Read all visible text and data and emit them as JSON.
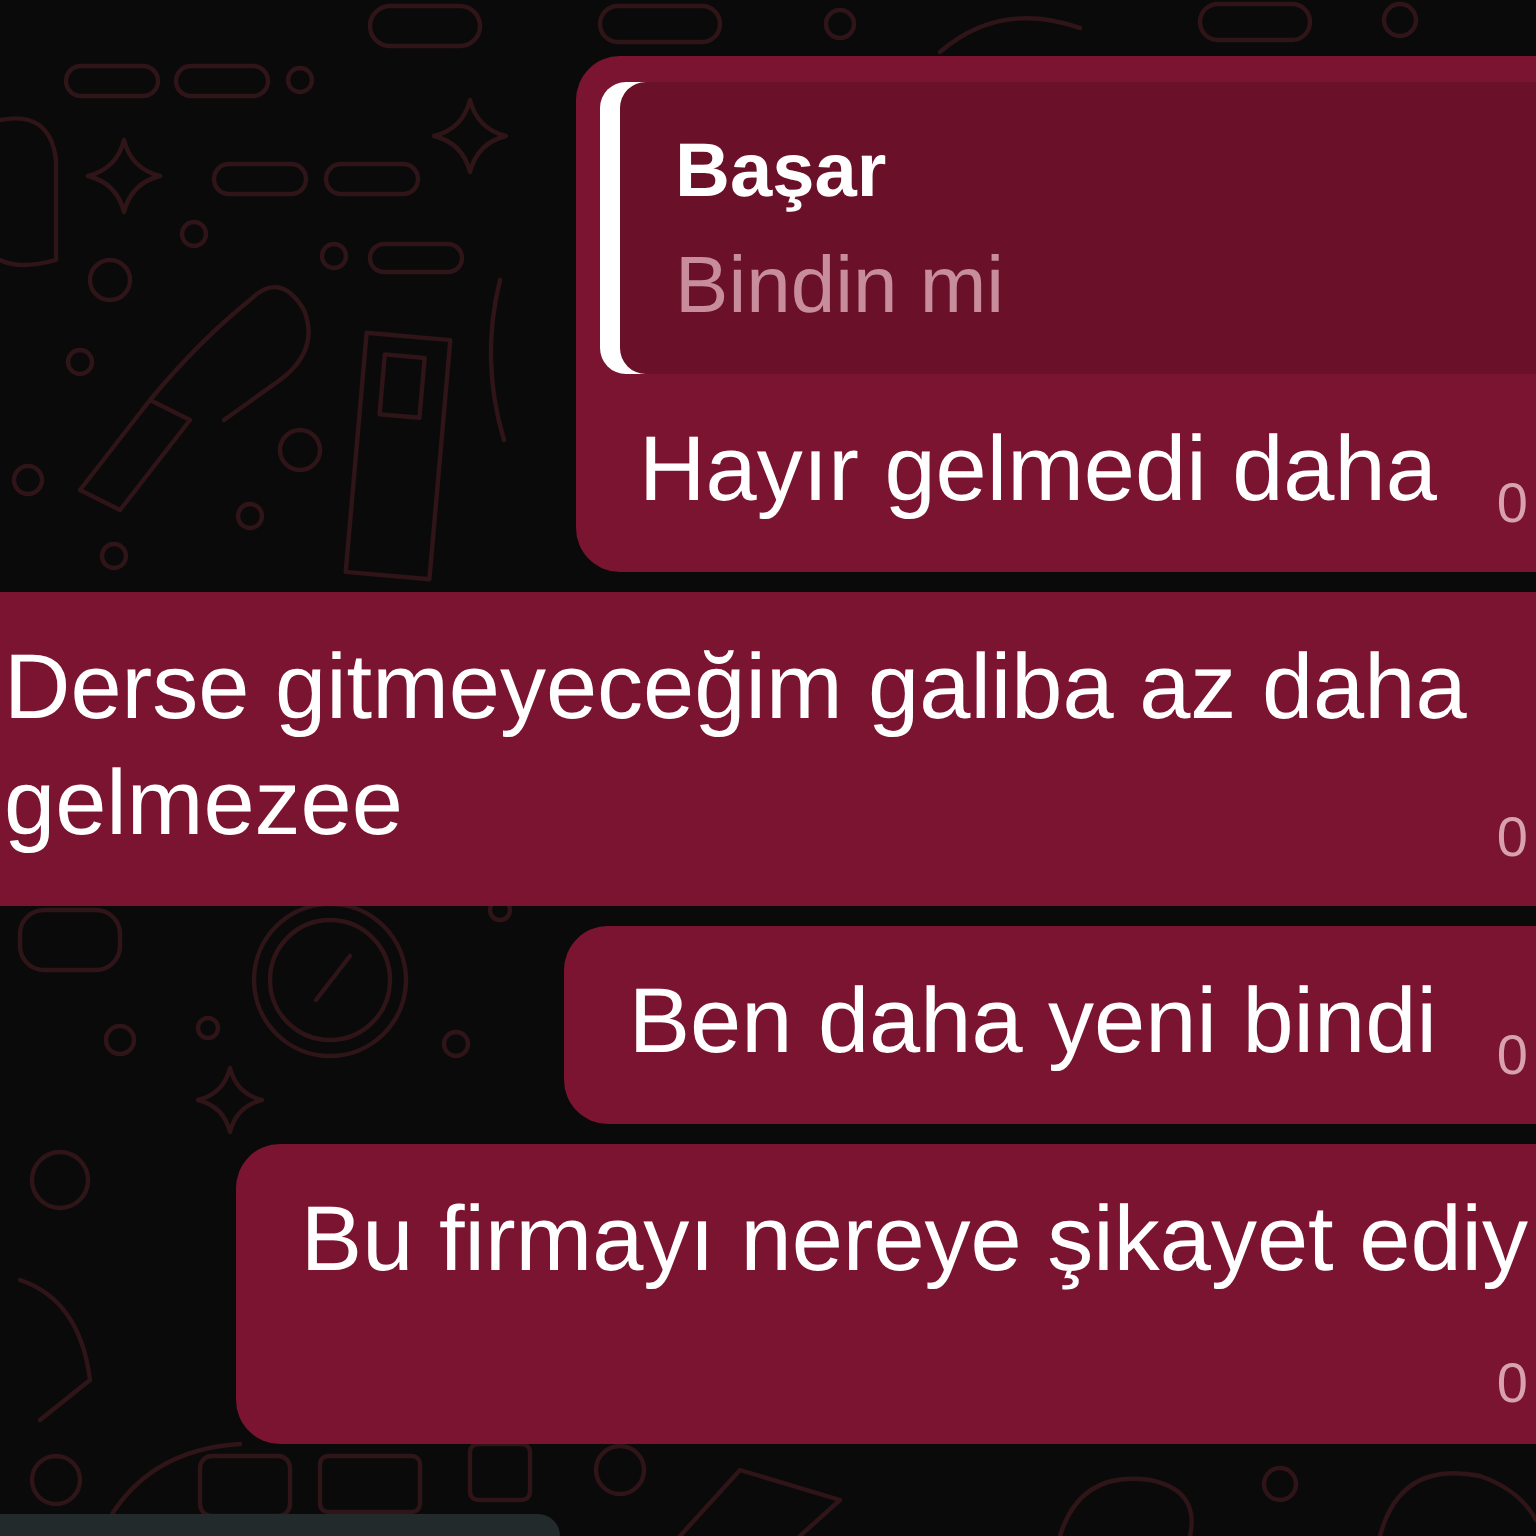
{
  "messages": [
    {
      "kind": "outgoing",
      "quote": {
        "author": "Başar",
        "text": "Bindin mi"
      },
      "text": "Hayır gelmedi daha",
      "time": "0"
    },
    {
      "kind": "outgoing",
      "text": "Derse gitmeyeceğim galiba az daha gelmezee",
      "time": "0"
    },
    {
      "kind": "outgoing",
      "text": "Ben daha yeni bindi",
      "time": "0"
    },
    {
      "kind": "outgoing",
      "text": "Bu firmayı nereye şikayet ediy",
      "time": "0"
    },
    {
      "kind": "incoming"
    }
  ]
}
